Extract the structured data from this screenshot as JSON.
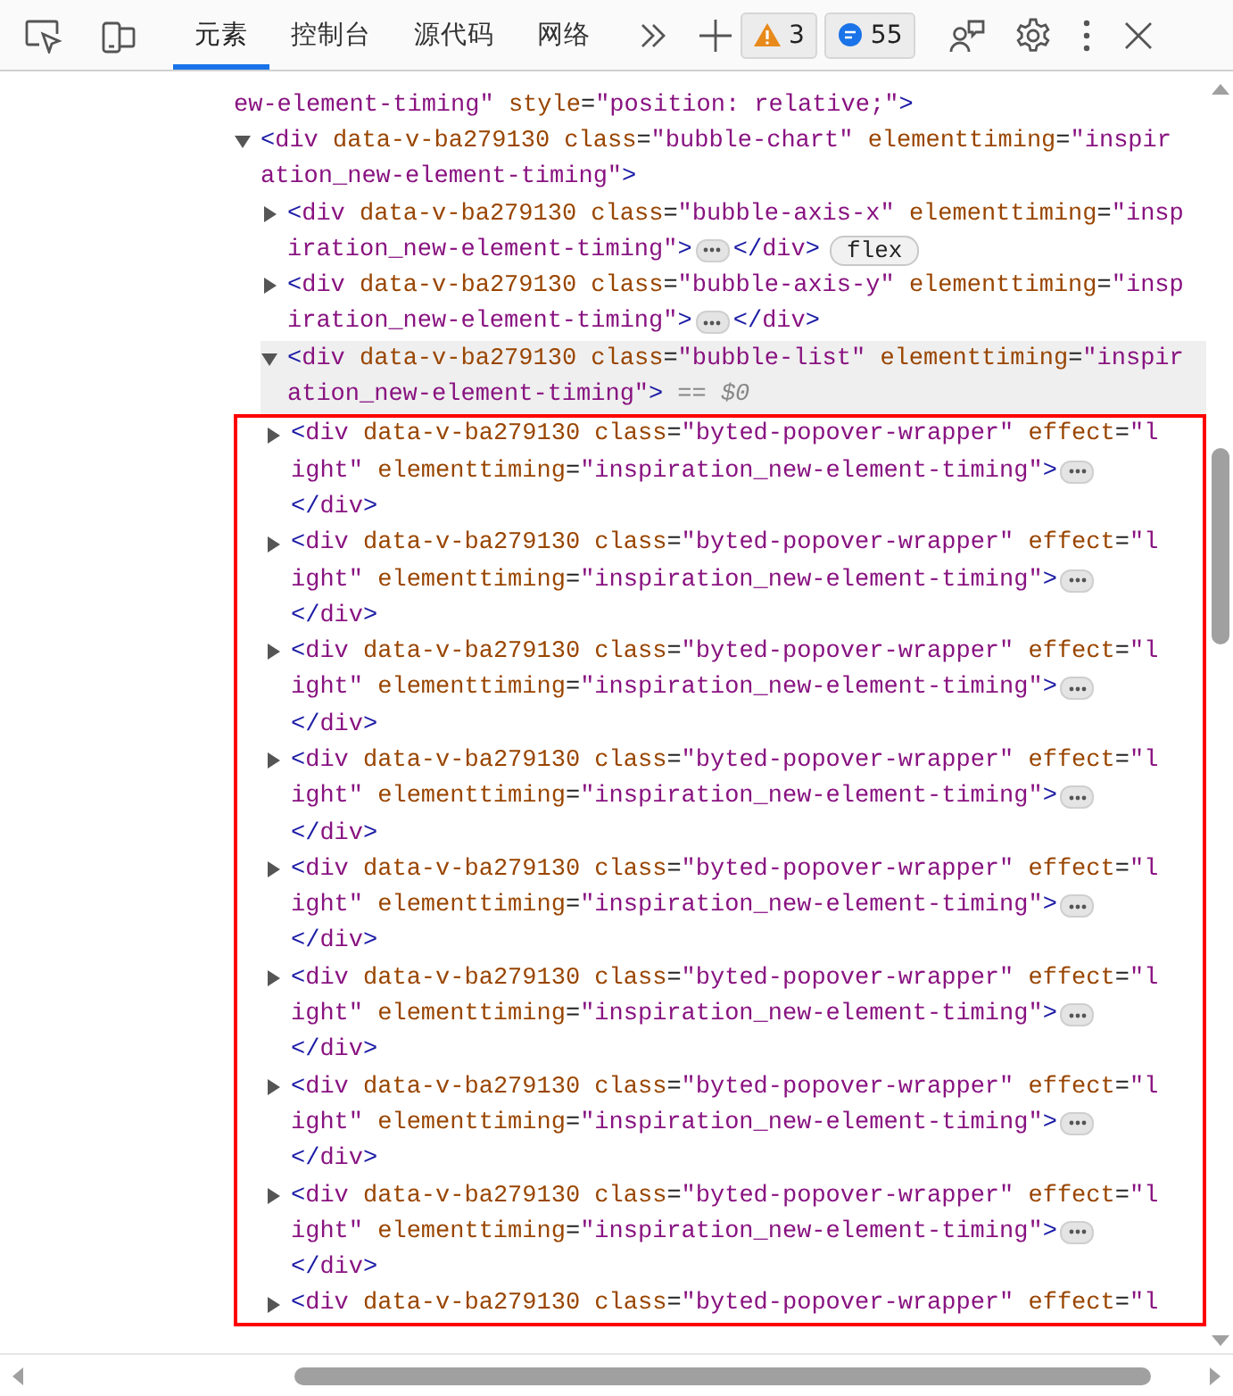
{
  "toolbar": {
    "tabs": [
      {
        "label": "元素",
        "selected": true
      },
      {
        "label": "控制台",
        "selected": false
      },
      {
        "label": "源代码",
        "selected": false
      },
      {
        "label": "网络",
        "selected": false
      }
    ],
    "warnings": "3",
    "messages": "55"
  },
  "tree": {
    "kind": "partial",
    "lines": [
      "ew-element-timing\" style=\"position: relative;\">"
    ],
    "children": [
      {
        "kind": "element",
        "expanded": true,
        "selected": false,
        "lines": [
          "<div data-v-ba279130 class=\"bubble-chart\" elementtiming=\"inspir",
          "ation_new-element-timing\">"
        ],
        "children": [
          {
            "kind": "element",
            "expanded": false,
            "selected": false,
            "lines": [
              "<div data-v-ba279130 class=\"bubble-axis-x\" elementtiming=\"insp",
              "iration_new-element-timing\">"
            ],
            "hidden_content": true,
            "close_tag": "</div>",
            "close_inline": true,
            "badge": "flex"
          },
          {
            "kind": "element",
            "expanded": false,
            "selected": false,
            "lines": [
              "<div data-v-ba279130 class=\"bubble-axis-y\" elementtiming=\"insp",
              "iration_new-element-timing\">"
            ],
            "hidden_content": true,
            "close_tag": "</div>",
            "close_inline": true
          },
          {
            "kind": "element",
            "expanded": true,
            "selected": true,
            "lines": [
              "<div data-v-ba279130 class=\"bubble-list\" elementtiming=\"inspir",
              "ation_new-element-timing\">"
            ],
            "suffix": "== $0",
            "children_outlined": true,
            "children": [
              {
                "kind": "element",
                "expanded": false,
                "selected": false,
                "lines": [
                  "<div data-v-ba279130 class=\"byted-popover-wrapper\" effect=\"l",
                  "ight\" elementtiming=\"inspiration_new-element-timing\">"
                ],
                "hidden_content": true,
                "close_tag": "</div>",
                "close_inline": false
              },
              {
                "kind": "element",
                "expanded": false,
                "selected": false,
                "lines": [
                  "<div data-v-ba279130 class=\"byted-popover-wrapper\" effect=\"l",
                  "ight\" elementtiming=\"inspiration_new-element-timing\">"
                ],
                "hidden_content": true,
                "close_tag": "</div>",
                "close_inline": false
              },
              {
                "kind": "element",
                "expanded": false,
                "selected": false,
                "lines": [
                  "<div data-v-ba279130 class=\"byted-popover-wrapper\" effect=\"l",
                  "ight\" elementtiming=\"inspiration_new-element-timing\">"
                ],
                "hidden_content": true,
                "close_tag": "</div>",
                "close_inline": false
              },
              {
                "kind": "element",
                "expanded": false,
                "selected": false,
                "lines": [
                  "<div data-v-ba279130 class=\"byted-popover-wrapper\" effect=\"l",
                  "ight\" elementtiming=\"inspiration_new-element-timing\">"
                ],
                "hidden_content": true,
                "close_tag": "</div>",
                "close_inline": false
              },
              {
                "kind": "element",
                "expanded": false,
                "selected": false,
                "lines": [
                  "<div data-v-ba279130 class=\"byted-popover-wrapper\" effect=\"l",
                  "ight\" elementtiming=\"inspiration_new-element-timing\">"
                ],
                "hidden_content": true,
                "close_tag": "</div>",
                "close_inline": false
              },
              {
                "kind": "element",
                "expanded": false,
                "selected": false,
                "lines": [
                  "<div data-v-ba279130 class=\"byted-popover-wrapper\" effect=\"l",
                  "ight\" elementtiming=\"inspiration_new-element-timing\">"
                ],
                "hidden_content": true,
                "close_tag": "</div>",
                "close_inline": false
              },
              {
                "kind": "element",
                "expanded": false,
                "selected": false,
                "lines": [
                  "<div data-v-ba279130 class=\"byted-popover-wrapper\" effect=\"l",
                  "ight\" elementtiming=\"inspiration_new-element-timing\">"
                ],
                "hidden_content": true,
                "close_tag": "</div>",
                "close_inline": false
              },
              {
                "kind": "element",
                "expanded": false,
                "selected": false,
                "lines": [
                  "<div data-v-ba279130 class=\"byted-popover-wrapper\" effect=\"l",
                  "ight\" elementtiming=\"inspiration_new-element-timing\">"
                ],
                "hidden_content": true,
                "close_tag": "</div>",
                "close_inline": false
              },
              {
                "kind": "element",
                "expanded": false,
                "selected": false,
                "lines": [
                  "<div data-v-ba279130 class=\"byted-popover-wrapper\" effect=\"l"
                ]
              }
            ]
          }
        ]
      }
    ]
  }
}
